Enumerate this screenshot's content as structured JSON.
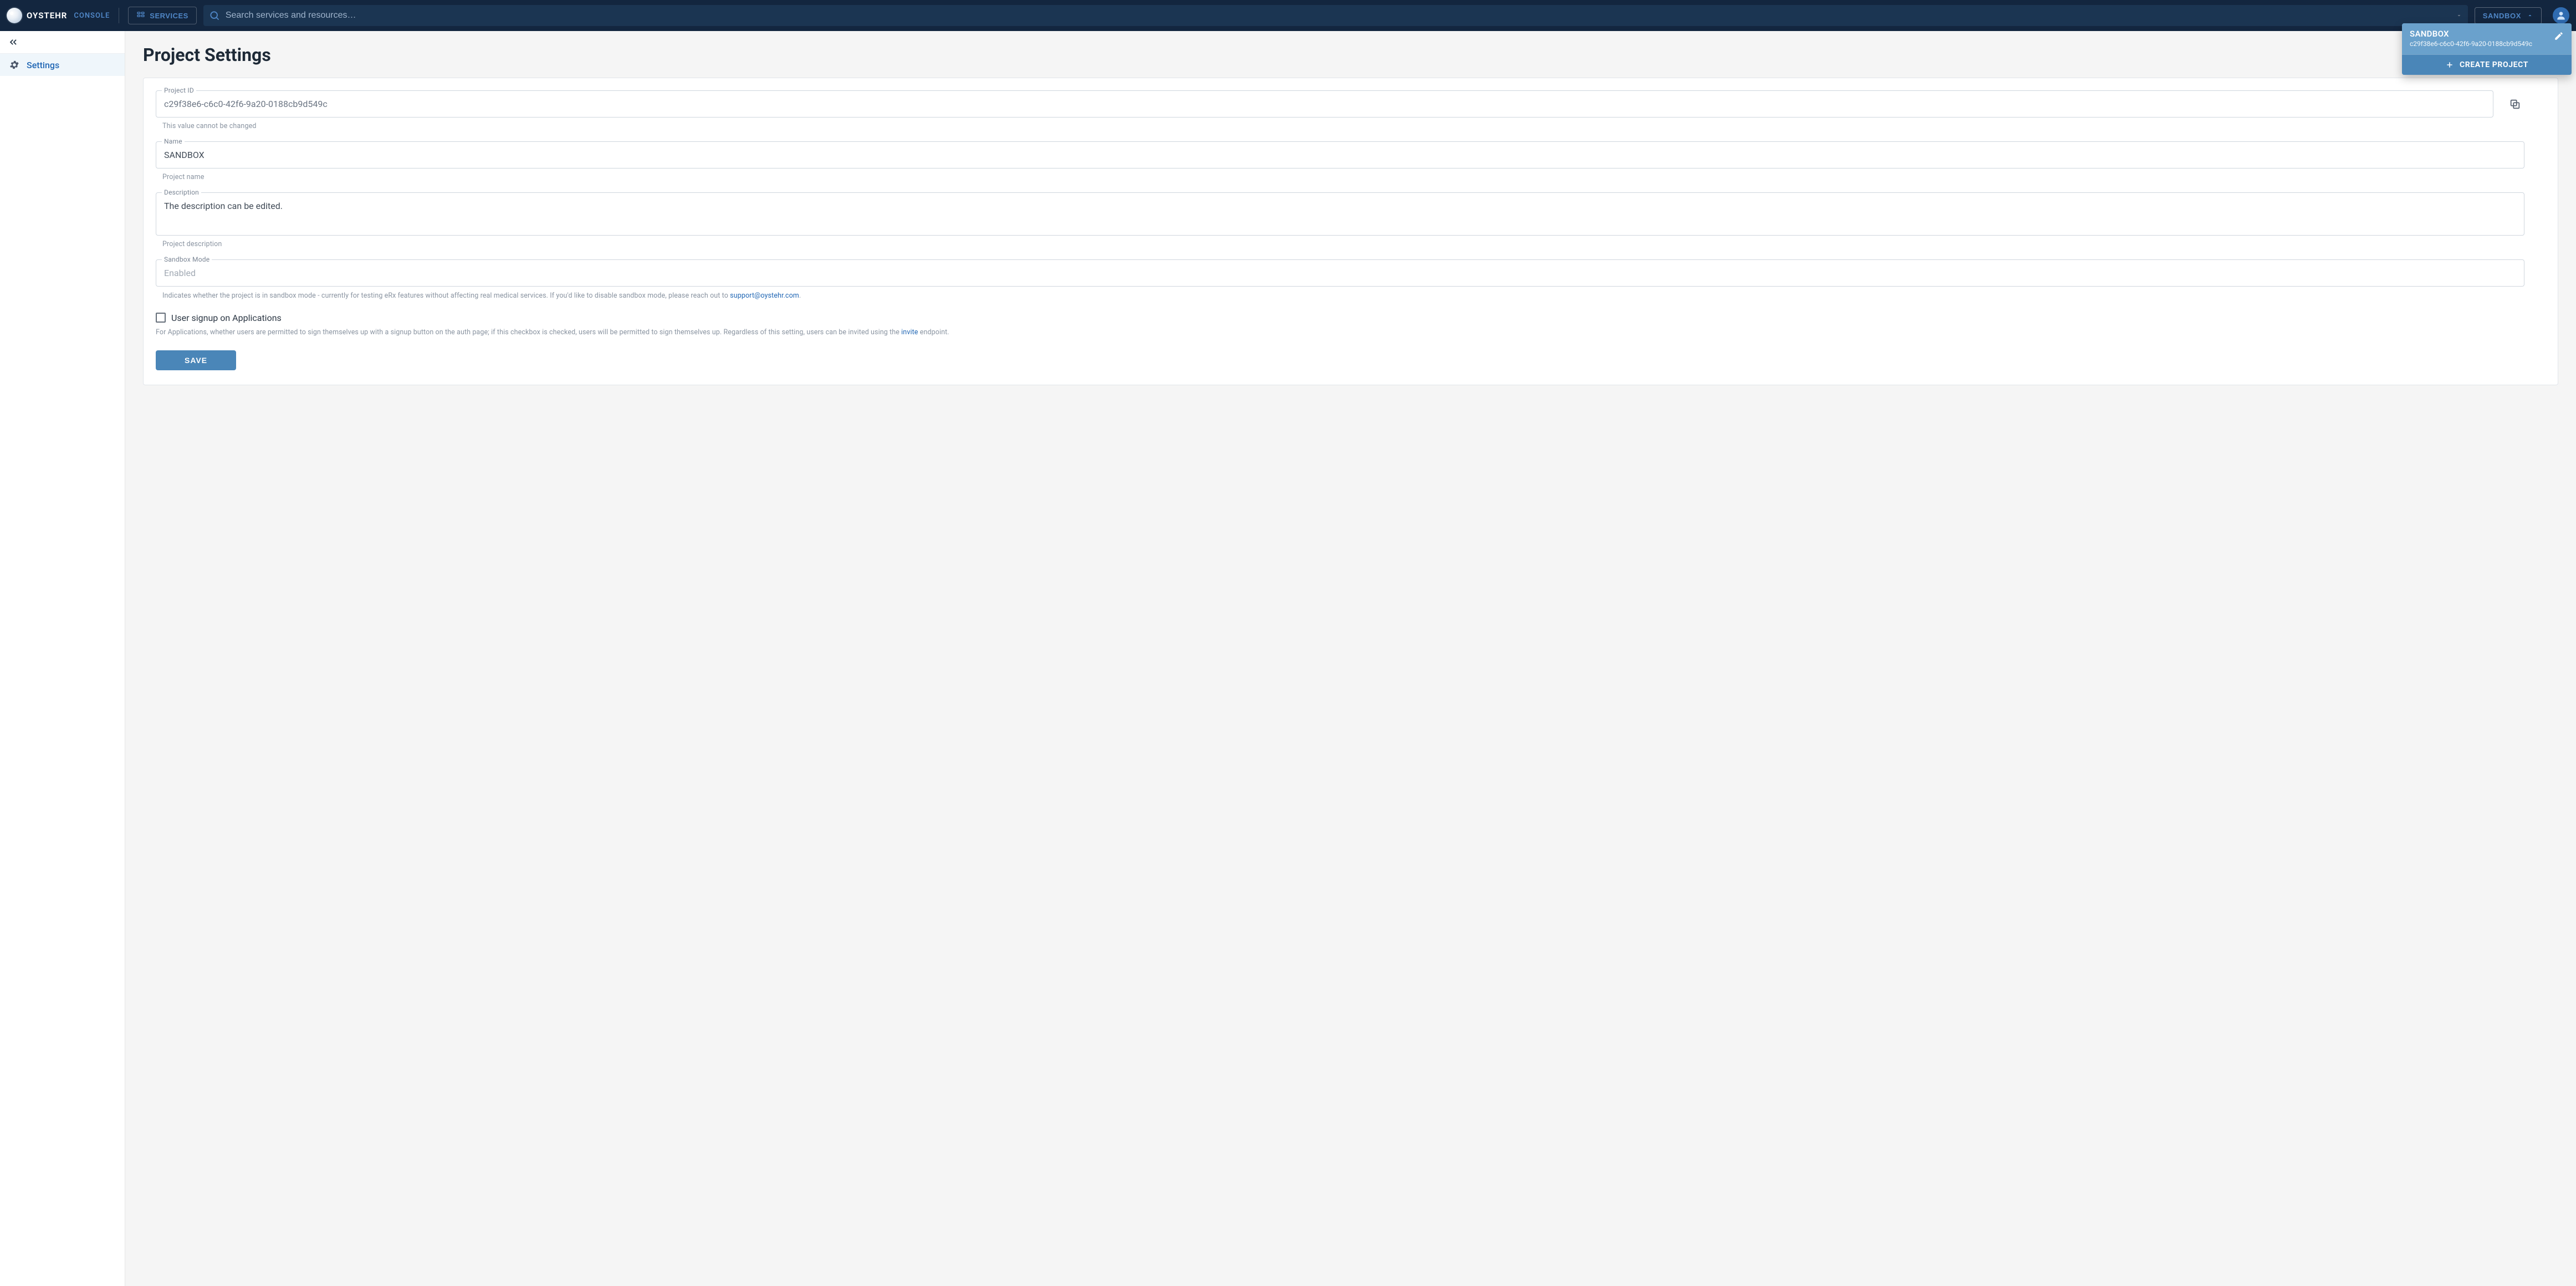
{
  "brand": {
    "name": "OYSTEHR",
    "sub": "CONSOLE"
  },
  "navbar": {
    "services_label": "SERVICES",
    "search_placeholder": "Search services and resources…",
    "project_selector_label": "SANDBOX"
  },
  "dropdown": {
    "project_name": "SANDBOX",
    "project_id": "c29f38e6-c6c0-42f6-9a20-0188cb9d549c",
    "create_label": "CREATE PROJECT"
  },
  "sidebar": {
    "items": [
      {
        "label": "Settings"
      }
    ]
  },
  "page": {
    "title": "Project Settings"
  },
  "form": {
    "project_id": {
      "label": "Project ID",
      "value": "c29f38e6-c6c0-42f6-9a20-0188cb9d549c",
      "helper": "This value cannot be changed"
    },
    "name": {
      "label": "Name",
      "value": "SANDBOX",
      "helper": "Project name"
    },
    "description": {
      "label": "Description",
      "value": "The description can be edited.",
      "helper": "Project description"
    },
    "sandbox_mode": {
      "label": "Sandbox Mode",
      "value": "Enabled",
      "helper_pre": "Indicates whether the project is in sandbox mode - currently for testing eRx features without affecting real medical services. If you'd like to disable sandbox mode, please reach out to ",
      "helper_link": "support@oystehr.com",
      "helper_post": "."
    },
    "signup_checkbox": {
      "label": "User signup on Applications",
      "checked": false
    },
    "signup_helper_pre": "For Applications, whether users are permitted to sign themselves up with a signup button on the auth page; if this checkbox is checked, users will be permitted to sign themselves up. Regardless of this setting, users can be invited using the ",
    "signup_helper_link": "invite",
    "signup_helper_post": " endpoint.",
    "save_label": "SAVE"
  }
}
